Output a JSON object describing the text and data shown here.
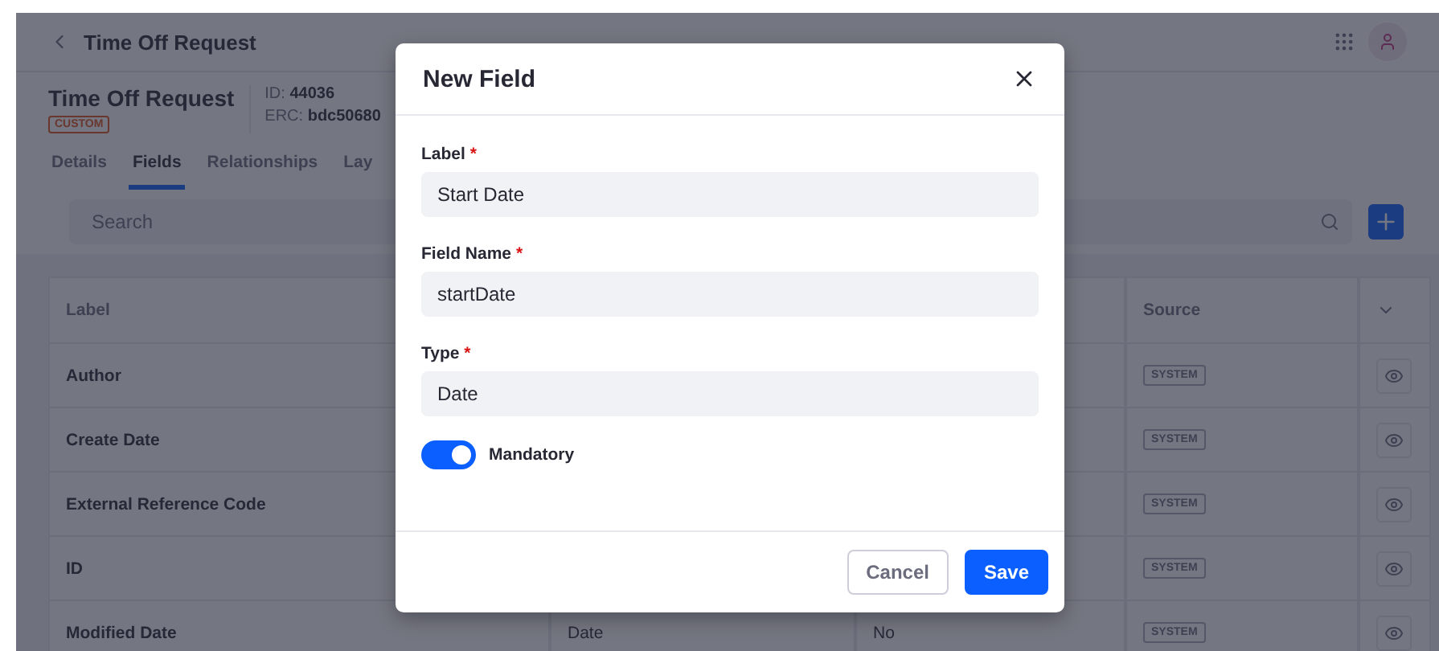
{
  "header": {
    "back_title": "Time Off Request"
  },
  "object": {
    "title": "Time Off Request",
    "badge": "CUSTOM",
    "id_label": "ID:",
    "id_value": "44036",
    "erc_label": "ERC:",
    "erc_value": "bdc50680"
  },
  "tabs": [
    {
      "label": "Details",
      "selected": false
    },
    {
      "label": "Fields",
      "selected": true
    },
    {
      "label": "Relationships",
      "selected": false
    },
    {
      "label": "Lay",
      "selected": false
    }
  ],
  "search": {
    "placeholder": "Search"
  },
  "table": {
    "columns": [
      {
        "label": "Label"
      },
      {},
      {},
      {
        "label": "Source"
      }
    ],
    "rows": [
      {
        "label": "Author",
        "source": "SYSTEM"
      },
      {
        "label": "Create Date",
        "source": "SYSTEM"
      },
      {
        "label": "External Reference Code",
        "source": "SYSTEM"
      },
      {
        "label": "ID",
        "source": "SYSTEM"
      },
      {
        "label": "Modified Date",
        "column_2": "Date",
        "column_3": "No",
        "source": "SYSTEM"
      }
    ]
  },
  "modal": {
    "title": "New Field",
    "fields": [
      {
        "label": "Label",
        "required_mark": "*",
        "value": "Start Date"
      },
      {
        "label": "Field Name",
        "required_mark": "*",
        "value": "startDate"
      },
      {
        "label": "Type",
        "required_mark": "*",
        "value": "Date"
      }
    ],
    "toggle": {
      "label": "Mandatory",
      "on": true
    },
    "buttons": [
      {
        "label": "Cancel",
        "kind": "secondary"
      },
      {
        "label": "Save",
        "kind": "primary"
      }
    ]
  }
}
